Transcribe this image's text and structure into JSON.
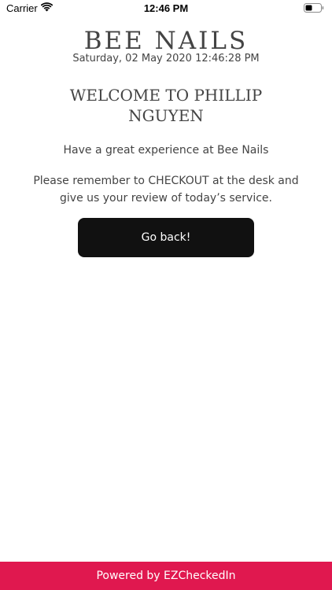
{
  "status_bar": {
    "carrier": "Carrier",
    "time": "12:46 PM",
    "wifi_icon": "wifi-icon",
    "battery_icon": "battery-icon"
  },
  "header": {
    "brand": "BEE NAILS",
    "datetime": "Saturday, 02 May 2020 12:46:28 PM"
  },
  "main": {
    "welcome": "WELCOME TO PHILLIP NGUYEN",
    "experience": "Have a great experience at Bee Nails",
    "reminder": "Please remember to CHECKOUT at the desk and give us your review of today’s service.",
    "back_label": "Go back!"
  },
  "footer": {
    "powered_by": "Powered by EZCheckedIn"
  },
  "colors": {
    "button_bg": "#111111",
    "footer_bg": "#e0184f",
    "text": "#444444"
  }
}
